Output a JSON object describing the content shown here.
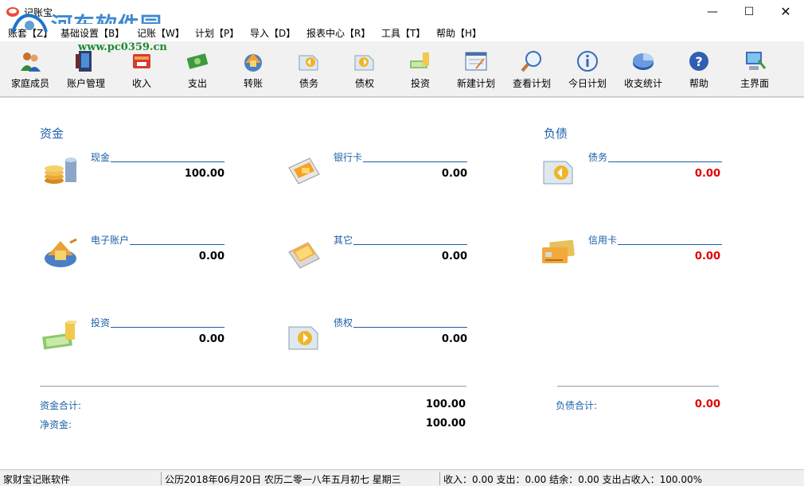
{
  "window": {
    "title": "记账宝"
  },
  "watermark": {
    "text": "河东软件园",
    "url": "www.pc0359.cn"
  },
  "menu": [
    {
      "label": "账套【Z】"
    },
    {
      "label": "基础设置【B】"
    },
    {
      "label": "记账【W】"
    },
    {
      "label": "计划【P】"
    },
    {
      "label": "导入【D】"
    },
    {
      "label": "报表中心【R】"
    },
    {
      "label": "工具【T】"
    },
    {
      "label": "帮助【H】"
    }
  ],
  "toolbar": [
    {
      "label": "家庭成员",
      "icon": "family-members-icon"
    },
    {
      "label": "账户管理",
      "icon": "account-manage-icon"
    },
    {
      "label": "收入",
      "icon": "income-icon"
    },
    {
      "label": "支出",
      "icon": "expense-icon"
    },
    {
      "label": "转账",
      "icon": "transfer-icon"
    },
    {
      "label": "债务",
      "icon": "debt-icon"
    },
    {
      "label": "债权",
      "icon": "credit-icon"
    },
    {
      "label": "投资",
      "icon": "investment-icon"
    },
    {
      "label": "新建计划",
      "icon": "new-plan-icon"
    },
    {
      "label": "查看计划",
      "icon": "view-plan-icon"
    },
    {
      "label": "今日计划",
      "icon": "today-plan-icon"
    },
    {
      "label": "收支统计",
      "icon": "statistics-icon"
    },
    {
      "label": "帮助",
      "icon": "help-icon"
    },
    {
      "label": "主界面",
      "icon": "main-screen-icon"
    }
  ],
  "assets": {
    "title": "资金",
    "items": [
      {
        "label": "现金",
        "value": "100.00",
        "icon": "cash-coins-icon"
      },
      {
        "label": "银行卡",
        "value": "0.00",
        "icon": "bank-card-icon"
      },
      {
        "label": "电子账户",
        "value": "0.00",
        "icon": "e-account-icon"
      },
      {
        "label": "其它",
        "value": "0.00",
        "icon": "other-icon"
      },
      {
        "label": "投资",
        "value": "0.00",
        "icon": "investment-money-icon"
      },
      {
        "label": "债权",
        "value": "0.00",
        "icon": "receivable-icon"
      }
    ],
    "total_label": "资金合计:",
    "total_value": "100.00",
    "net_label": "净资金:",
    "net_value": "100.00"
  },
  "liabilities": {
    "title": "负债",
    "items": [
      {
        "label": "债务",
        "value": "0.00",
        "icon": "debt-folder-icon"
      },
      {
        "label": "信用卡",
        "value": "0.00",
        "icon": "credit-card-icon"
      }
    ],
    "total_label": "负债合计:",
    "total_value": "0.00"
  },
  "status": {
    "app_name": "家财宝记账软件",
    "date": "公历2018年06月20日 农历二零一八年五月初七  星期三",
    "summary": "收入：0.00 支出：0.00 结余：0.00 支出占收入：100.00%"
  },
  "colors": {
    "accent": "#1a5fa8",
    "negative": "#e00000",
    "watermark": "#1d75c9"
  }
}
